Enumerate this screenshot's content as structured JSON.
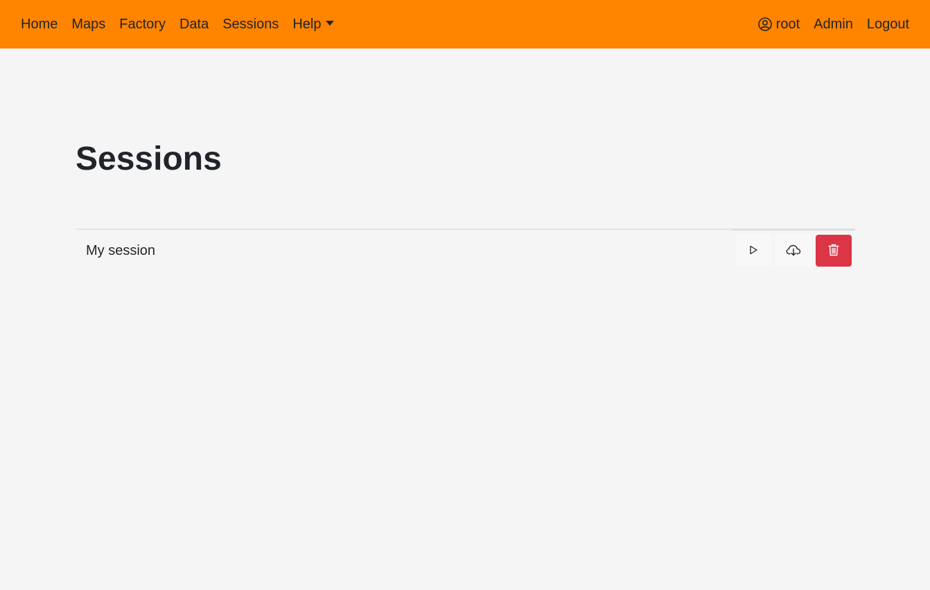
{
  "nav": {
    "home": "Home",
    "maps": "Maps",
    "factory": "Factory",
    "data": "Data",
    "sessions": "Sessions",
    "help": "Help",
    "user": "root",
    "admin": "Admin",
    "logout": "Logout"
  },
  "page": {
    "title": "Sessions"
  },
  "sessions": [
    {
      "name": "My session",
      "actions": [
        "play-icon",
        "cloud-download-icon",
        "trash-icon"
      ]
    }
  ],
  "colors": {
    "navbar": "#ff8400",
    "danger": "#dc3545",
    "background": "#f5f5f5"
  }
}
